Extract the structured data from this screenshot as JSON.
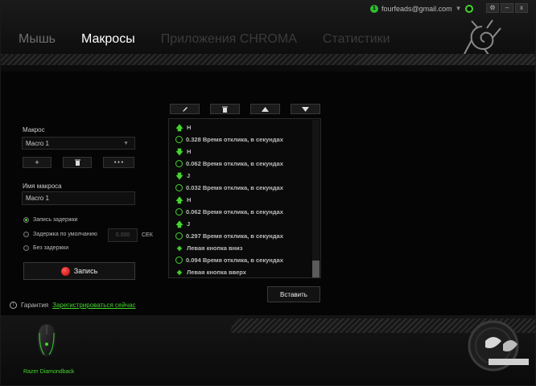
{
  "account": {
    "badge": "1",
    "username": "fourfeads@gmail.com"
  },
  "window": {
    "settings": "⚙",
    "minimize": "–",
    "close": "x"
  },
  "tabs": [
    {
      "label": "Мышь"
    },
    {
      "label": "Макросы"
    },
    {
      "label": "Приложения CHROMA"
    },
    {
      "label": "Статистики"
    }
  ],
  "left": {
    "macro_label": "Макрос",
    "macro_select": "Macro 1",
    "add_button": "+",
    "more_button": "• • •",
    "name_label": "Имя макроса",
    "name_value": "Macro 1",
    "radio_record_delay": "Запись задержки",
    "radio_default_delay": "Задержка по умолчанию",
    "delay_value": "0.000",
    "delay_unit": "СЕК",
    "radio_no_delay": "Без задержки",
    "record_button": "Запись"
  },
  "warranty": {
    "label": "Гарантия",
    "link": "Зарегистрироваться сейчас"
  },
  "macro_steps": [
    {
      "type": "up",
      "text": "H"
    },
    {
      "type": "delay",
      "text": "0.328 Время отклика, в секундах"
    },
    {
      "type": "down",
      "text": "H"
    },
    {
      "type": "delay",
      "text": "0.062 Время отклика, в секундах"
    },
    {
      "type": "down",
      "text": "J"
    },
    {
      "type": "delay",
      "text": "0.032 Время отклика, в секундах"
    },
    {
      "type": "up",
      "text": "H"
    },
    {
      "type": "delay",
      "text": "0.062 Время отклика, в секундах"
    },
    {
      "type": "up",
      "text": "J"
    },
    {
      "type": "delay",
      "text": "0.297 Время отклика, в секундах"
    },
    {
      "type": "mouse",
      "text": "Левая кнопка вниз"
    },
    {
      "type": "delay",
      "text": "0.094 Время отклика, в секундах"
    },
    {
      "type": "mouse",
      "text": "Левая кнопка вверх"
    }
  ],
  "insert_button": "Вставить",
  "device": {
    "name": "Razer Diamondback"
  },
  "colors": {
    "accent": "#44d62c",
    "record": "#e01010"
  }
}
